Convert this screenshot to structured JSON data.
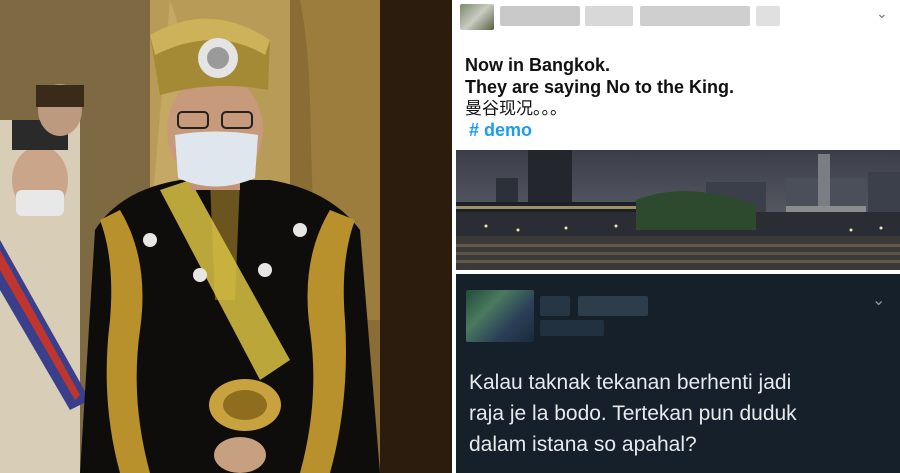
{
  "tweet_top": {
    "lines": [
      "Now in Bangkok.",
      "They are saying No to the King.",
      "曼谷现况。。。"
    ],
    "hashtag": "# demo"
  },
  "tweet_dark": {
    "lines": [
      "Kalau taknak tekanan berhenti jadi",
      "raja je la bodo. Tertekan pun duduk",
      "dalam istana so apahal?"
    ]
  },
  "icons": {
    "top_menu": "chevron-down-icon",
    "dark_menu": "chevron-down-icon"
  },
  "colors": {
    "hashtag": "#1d9bf0",
    "dark_bg": "#15202b",
    "dark_text": "#e7e9ea"
  }
}
